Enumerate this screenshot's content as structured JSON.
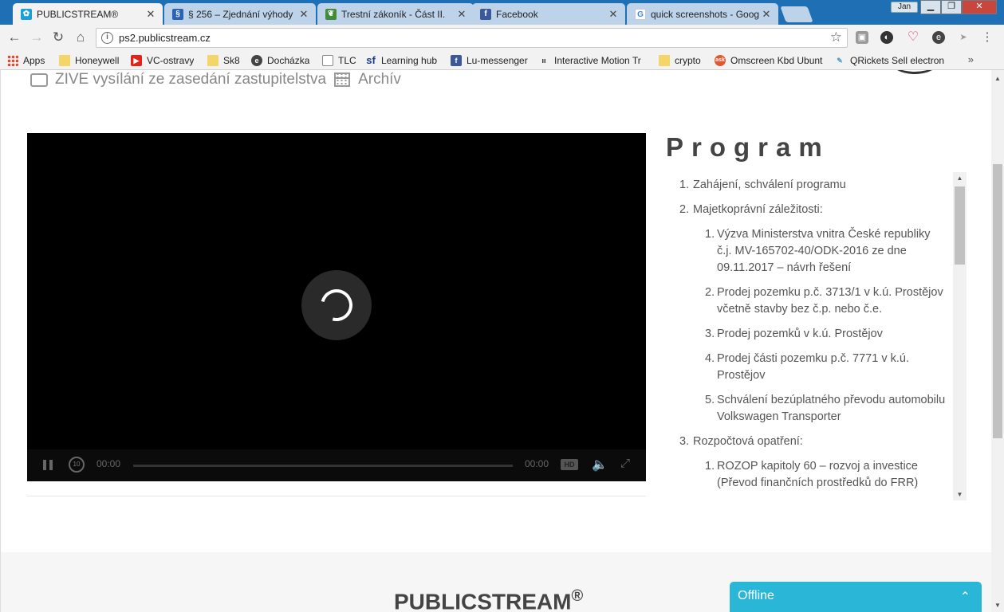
{
  "browser": {
    "tabs": [
      {
        "title": "PUBLICSTREAM®",
        "icon": "publicstream-icon",
        "color": "#1a9fd9",
        "active": true
      },
      {
        "title": "§ 256 – Zjednání výhody",
        "icon": "paragraph-icon",
        "color": "#2a63b8",
        "active": false
      },
      {
        "title": "Trestní zákoník - Část II.",
        "icon": "leaf-icon",
        "color": "#3f8c3a",
        "active": false
      },
      {
        "title": "Facebook",
        "icon": "facebook-icon",
        "color": "#3b5998",
        "active": false
      },
      {
        "title": "quick screenshots - Goog",
        "icon": "google-icon",
        "color": "#4285f4",
        "active": false
      }
    ],
    "user_label": "Jan",
    "url": "ps2.publicstream.cz",
    "bookmarks": [
      {
        "label": "Apps",
        "icon": "apps-grid-icon"
      },
      {
        "label": "Honeywell",
        "icon": "folder-icon"
      },
      {
        "label": "VC-ostravy",
        "icon": "youtube-icon"
      },
      {
        "label": "Sk8",
        "icon": "folder-icon"
      },
      {
        "label": "Docházka",
        "icon": "e-icon"
      },
      {
        "label": "TLC",
        "icon": "page-icon"
      },
      {
        "label": "Learning hub",
        "icon": "sf-icon"
      },
      {
        "label": "Lu-messenger",
        "icon": "facebook-icon"
      },
      {
        "label": "Interactive Motion Tr",
        "icon": "im-icon"
      },
      {
        "label": "crypto",
        "icon": "folder-icon"
      },
      {
        "label": "Omscreen Kbd Ubunt",
        "icon": "ask-icon"
      },
      {
        "label": "QRickets Sell electron",
        "icon": "qrickets-icon"
      }
    ]
  },
  "page": {
    "nav": {
      "live_label": "ZIVE vysílání ze zasedání zastupitelstva",
      "archive_label": "Archív"
    },
    "player": {
      "time_current": "00:00",
      "time_total": "00:00",
      "hd_label": "HD",
      "replay_label": "10"
    },
    "program": {
      "title": "Program",
      "items": [
        {
          "n": "1.",
          "text": "Zahájení, schválení programu"
        },
        {
          "n": "2.",
          "text": "Majetkoprávní záležitosti:",
          "sub": [
            {
              "n": "1.",
              "text": "Výzva Ministerstva vnitra České republiky č.j. MV-165702-40/ODK-2016 ze dne 09.11.2017 – návrh řešení"
            },
            {
              "n": "2.",
              "text": "Prodej pozemku p.č. 3713/1 v k.ú. Prostějov včetně stavby bez č.p. nebo č.e."
            },
            {
              "n": "3.",
              "text": "Prodej pozemků v k.ú. Prostějov"
            },
            {
              "n": "4.",
              "text": "Prodej části pozemku p.č. 7771 v k.ú. Prostějov"
            },
            {
              "n": "5.",
              "text": "Schválení bezúplatného převodu automobilu Volkswagen Transporter"
            }
          ]
        },
        {
          "n": "3.",
          "text": "Rozpočtová opatření:",
          "sub": [
            {
              "n": "1.",
              "text": "ROZOP kapitoly 60 – rozvoj a investice (Převod finančních prostředků do FRR)"
            }
          ]
        }
      ]
    },
    "footer": {
      "brand": "PUBLICSTREAM",
      "reg": "®"
    },
    "chat": {
      "status": "Offline"
    }
  }
}
